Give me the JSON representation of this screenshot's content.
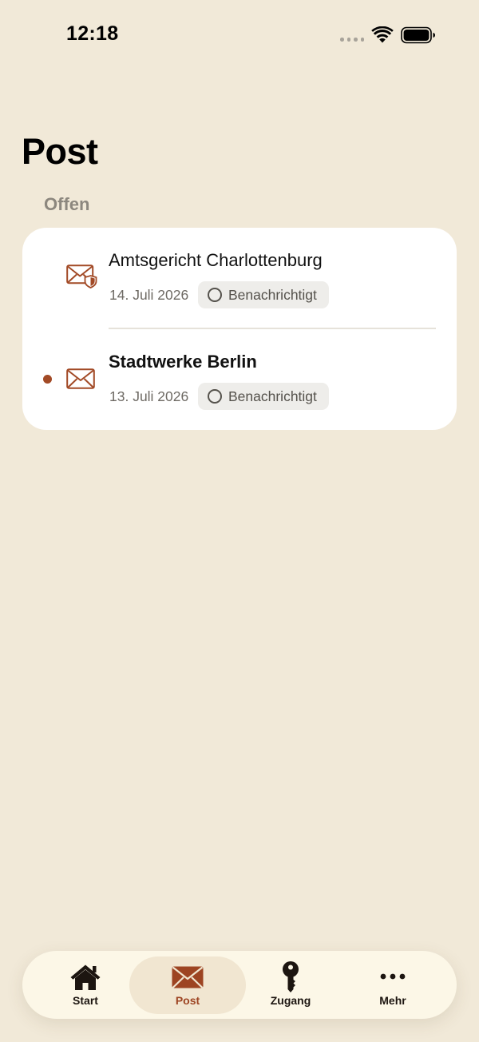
{
  "status_bar": {
    "time": "12:18"
  },
  "header": {
    "title": "Post"
  },
  "section": {
    "label": "Offen"
  },
  "colors": {
    "accent": "#9D4422",
    "background": "#F1E9D8",
    "card": "#FFFFFF",
    "unread_dot": "#A24A26"
  },
  "mail_items": [
    {
      "sender": "Amtsgericht Charlottenburg",
      "date": "14. Juli 2026",
      "status": "Benachrichtigt",
      "icon": "shielded-mail-icon",
      "unread": false
    },
    {
      "sender": "Stadtwerke Berlin",
      "date": "13. Juli 2026",
      "status": "Benachrichtigt",
      "icon": "mail-icon",
      "unread": true
    }
  ],
  "tabs": [
    {
      "label": "Start",
      "icon": "home-icon",
      "active": false
    },
    {
      "label": "Post",
      "icon": "mail-icon",
      "active": true
    },
    {
      "label": "Zugang",
      "icon": "key-icon",
      "active": false
    },
    {
      "label": "Mehr",
      "icon": "more-icon",
      "active": false
    }
  ]
}
